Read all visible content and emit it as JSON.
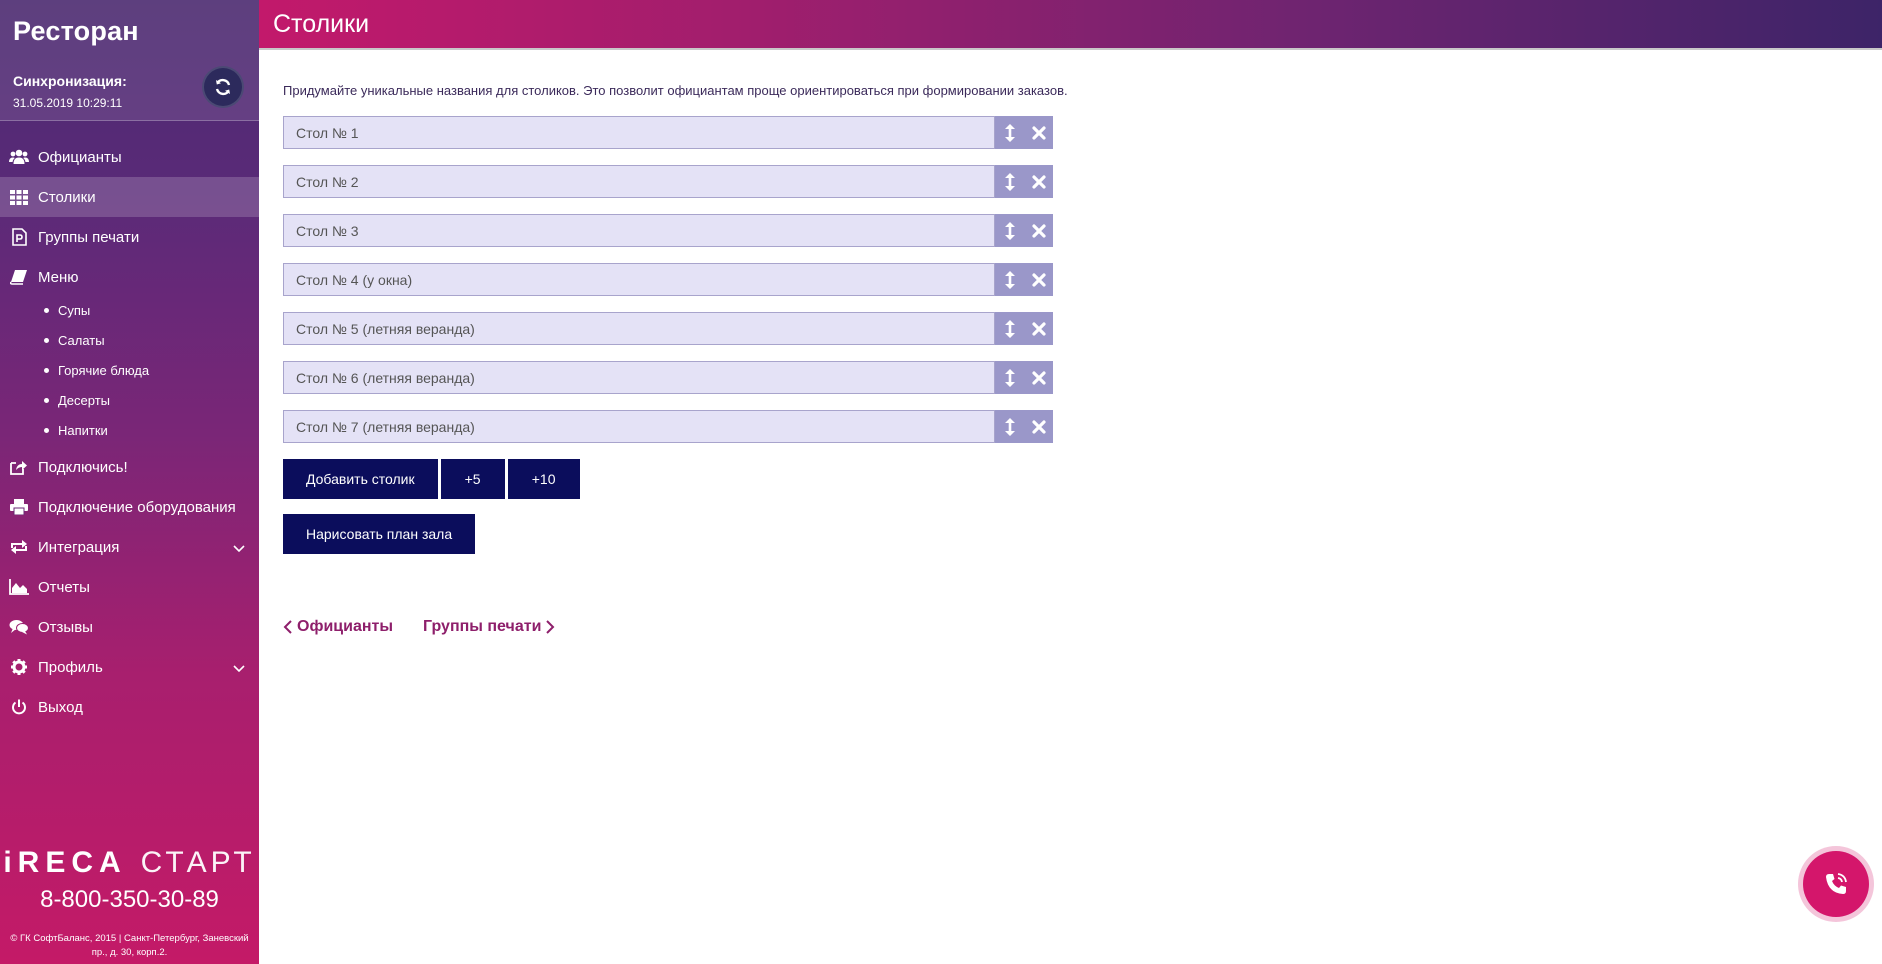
{
  "sidebar": {
    "app_title": "Ресторан",
    "sync_label": "Синхронизация:",
    "sync_time": "31.05.2019 10:29:11",
    "nav": [
      {
        "label": "Официанты",
        "icon": "users-icon"
      },
      {
        "label": "Столики",
        "icon": "grid-icon",
        "active": true
      },
      {
        "label": "Группы печати",
        "icon": "print-group-icon"
      },
      {
        "label": "Меню",
        "icon": "book-icon"
      }
    ],
    "menu_sub": [
      "Супы",
      "Салаты",
      "Горячие блюда",
      "Десерты",
      "Напитки"
    ],
    "nav2": [
      {
        "label": "Подключись!",
        "icon": "share-icon"
      },
      {
        "label": "Подключение оборудования",
        "icon": "printer-icon"
      },
      {
        "label": "Интеграция",
        "icon": "exchange-icon",
        "expandable": true
      },
      {
        "label": "Отчеты",
        "icon": "area-chart-icon"
      },
      {
        "label": "Отзывы",
        "icon": "comments-icon"
      },
      {
        "label": "Профиль",
        "icon": "gear-icon",
        "expandable": true
      },
      {
        "label": "Выход",
        "icon": "power-icon"
      }
    ],
    "brand_main": "iRECA",
    "brand_sub": "СТАРТ",
    "phone": "8-800-350-30-89",
    "copyright": "© ГК СофтБаланс, 2015 | Санкт-Петербург, Заневский пр., д. 30, корп.2."
  },
  "header": {
    "title": "Столики"
  },
  "main": {
    "hint": "Придумайте уникальные названия для столиков. Это позволит официантам проще ориентироваться при формировании заказов.",
    "tables": [
      "Стол № 1",
      "Стол № 2",
      "Стол № 3",
      "Стол № 4 (у окна)",
      "Стол № 5 (летняя веранда)",
      "Стол № 6 (летняя веранда)",
      "Стол № 7 (летняя веранда)"
    ],
    "add_label": "Добавить столик",
    "plus5_label": "+5",
    "plus10_label": "+10",
    "plan_label": "Нарисовать план зала",
    "prev_label": "Официанты",
    "next_label": "Группы печати"
  },
  "colors": {
    "accent": "#0b0d5c",
    "link": "#8e1f6b",
    "call": "#d4166b",
    "input_bg": "#e4e2f6"
  }
}
